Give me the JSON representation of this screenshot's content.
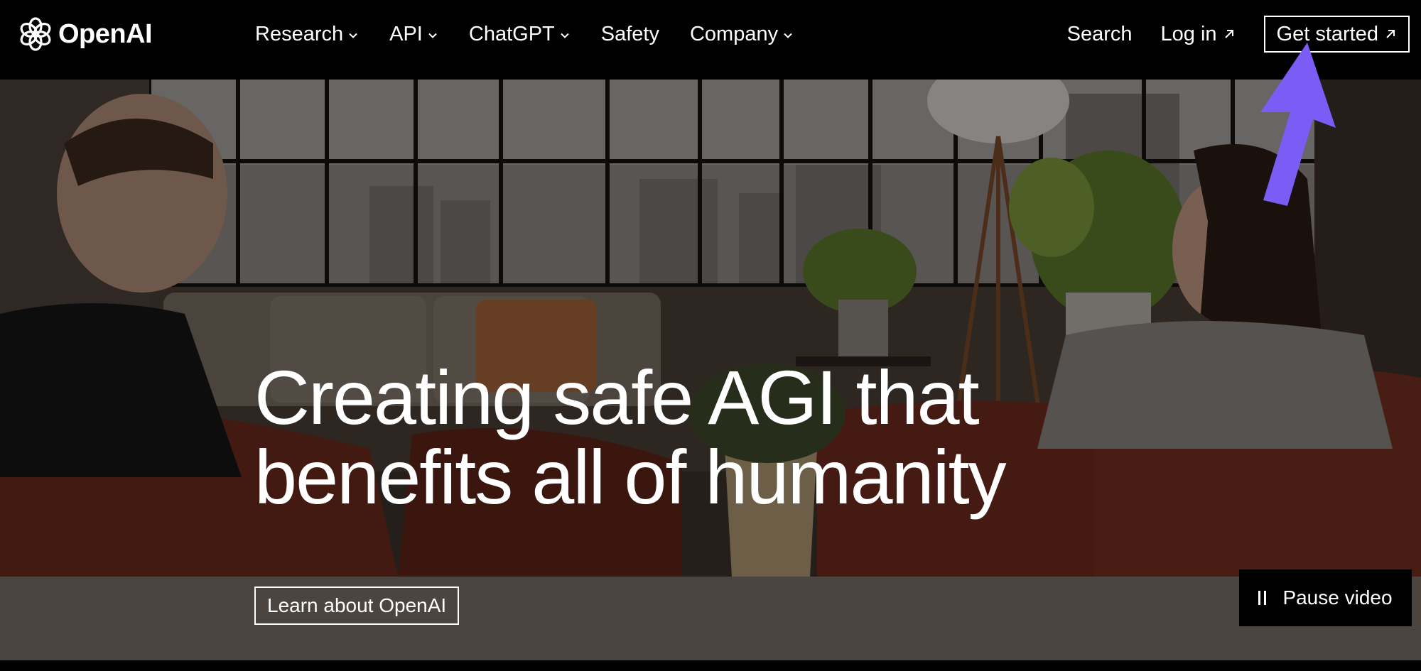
{
  "brand": {
    "name": "OpenAI",
    "logo_icon": "openai-knot-icon"
  },
  "nav": {
    "items": [
      {
        "label": "Research",
        "has_dropdown": true
      },
      {
        "label": "API",
        "has_dropdown": true
      },
      {
        "label": "ChatGPT",
        "has_dropdown": true
      },
      {
        "label": "Safety",
        "has_dropdown": false
      },
      {
        "label": "Company",
        "has_dropdown": true
      }
    ],
    "search_label": "Search",
    "login_label": "Log in",
    "get_started_label": "Get started"
  },
  "hero": {
    "title_line1": "Creating safe AGI that",
    "title_line2": "benefits all of humanity",
    "learn_button": "Learn about OpenAI",
    "pause_button": "Pause video"
  },
  "annotation": {
    "type": "arrow",
    "color": "#7b5cf5",
    "points_to": "Get started"
  },
  "colors": {
    "nav_bg": "#000000",
    "text": "#ffffff",
    "annotation": "#7b5cf5"
  }
}
